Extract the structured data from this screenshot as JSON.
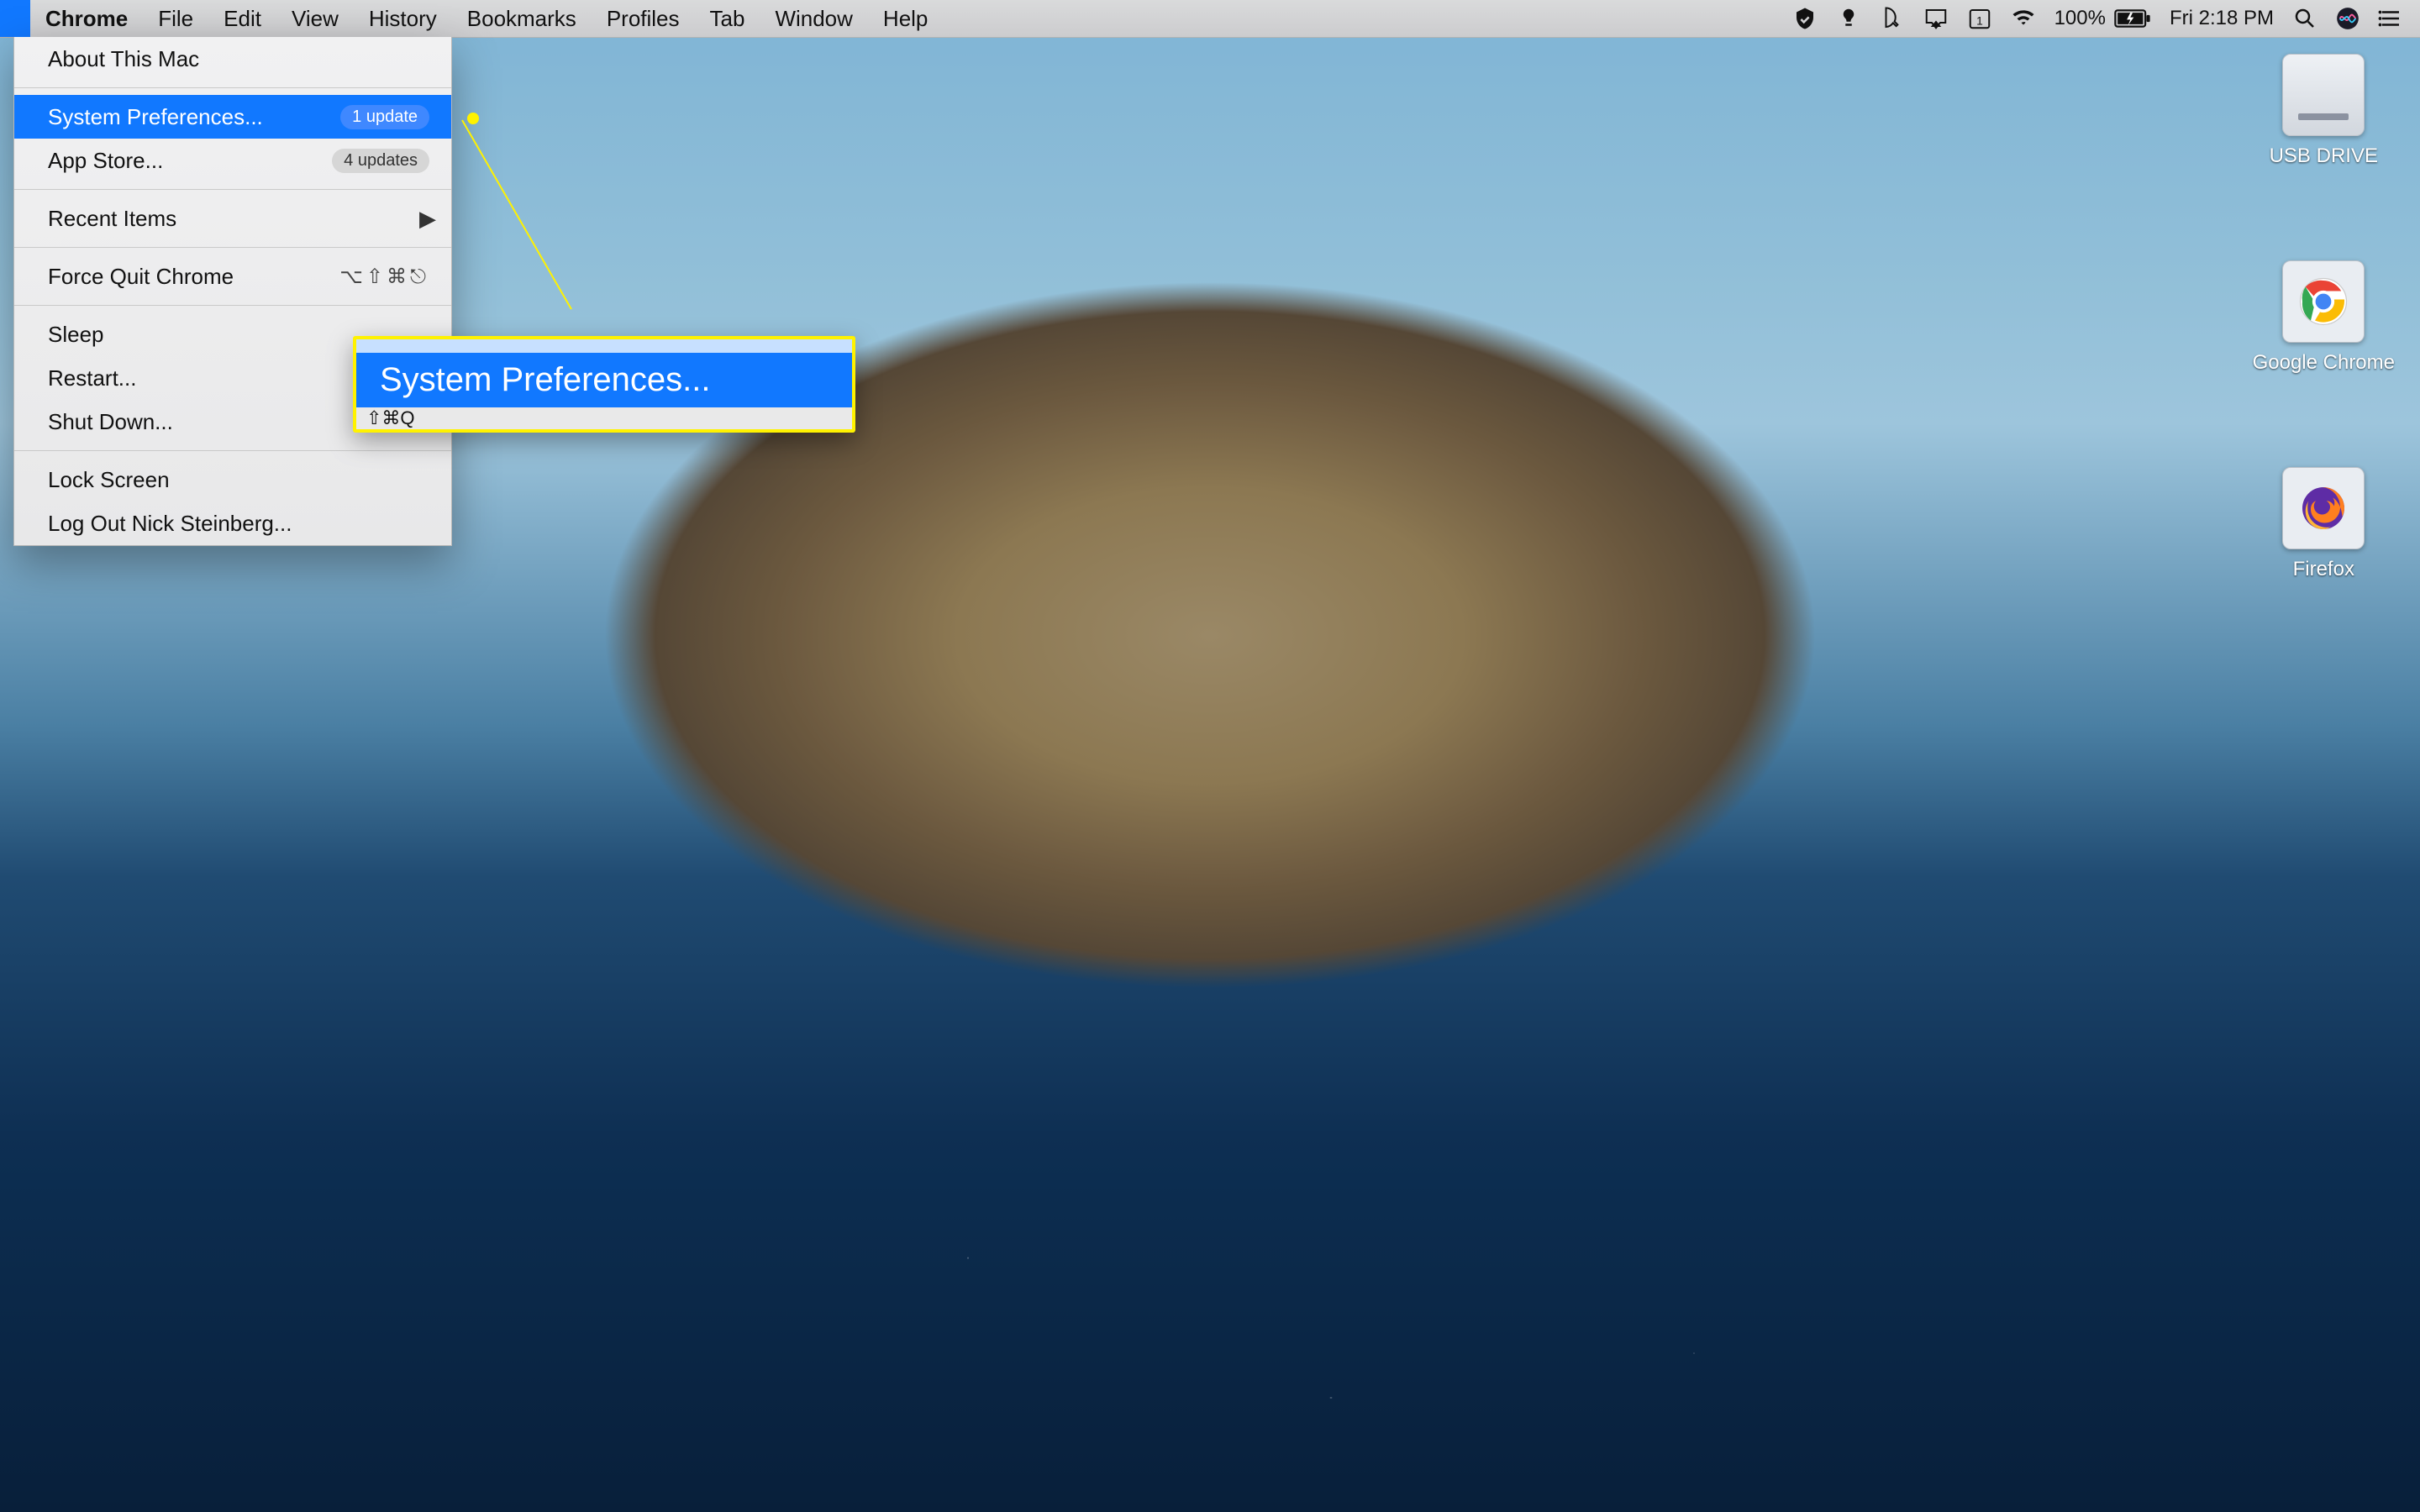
{
  "menubar": {
    "app_menus": [
      "Chrome",
      "File",
      "Edit",
      "View",
      "History",
      "Bookmarks",
      "Profiles",
      "Tab",
      "Window",
      "Help"
    ],
    "battery_percent": "100%",
    "clock": "Fri 2:18 PM"
  },
  "apple_menu": {
    "items": [
      {
        "label": "About This Mac"
      },
      {
        "sep": true
      },
      {
        "label": "System Preferences...",
        "badge": "1 update",
        "highlighted": true
      },
      {
        "label": "App Store...",
        "badge": "4 updates"
      },
      {
        "sep": true
      },
      {
        "label": "Recent Items",
        "submenu": true
      },
      {
        "sep": true
      },
      {
        "label": "Force Quit Chrome",
        "shortcut": "⌥⇧⌘⎋"
      },
      {
        "sep": true
      },
      {
        "label": "Sleep"
      },
      {
        "label": "Restart..."
      },
      {
        "label": "Shut Down..."
      },
      {
        "sep": true
      },
      {
        "label": "Lock Screen"
      },
      {
        "label": "Log Out Nick Steinberg..."
      }
    ]
  },
  "callout": {
    "title": "System Preferences...",
    "foot_shortcut": "⇧⌘Q"
  },
  "desktop_icons": [
    {
      "name": "USB DRIVE",
      "kind": "drive"
    },
    {
      "name": "Google Chrome",
      "kind": "chrome"
    },
    {
      "name": "Firefox",
      "kind": "firefox"
    }
  ]
}
